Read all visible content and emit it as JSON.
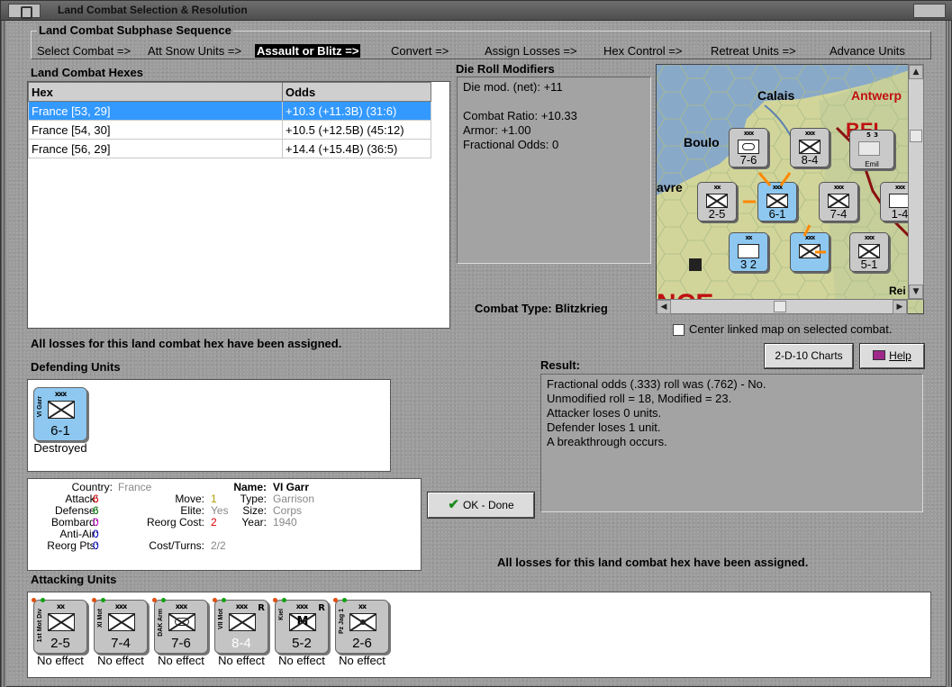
{
  "window": {
    "title": "Land Combat Selection & Resolution"
  },
  "sequence": {
    "title": "Land Combat Subphase Sequence",
    "steps": [
      {
        "label": "Select Combat =>",
        "active": false
      },
      {
        "label": "Att Snow Units =>",
        "active": false
      },
      {
        "label": "Assault or Blitz =>",
        "active": true
      },
      {
        "label": "Convert =>",
        "active": false
      },
      {
        "label": "Assign Losses =>",
        "active": false
      },
      {
        "label": "Hex Control =>",
        "active": false
      },
      {
        "label": "Retreat Units =>",
        "active": false
      },
      {
        "label": "Advance Units",
        "active": false
      }
    ]
  },
  "hexes": {
    "title": "Land Combat Hexes",
    "columns": [
      "Hex",
      "Odds"
    ],
    "rows": [
      {
        "hex": "France [53, 29]",
        "odds": "+10.3 (+11.3B) (31:6)",
        "selected": true
      },
      {
        "hex": "France [54, 30]",
        "odds": "+10.5 (+12.5B) (45:12)",
        "selected": false
      },
      {
        "hex": "France [56, 29]",
        "odds": "+14.4 (+15.4B) (36:5)",
        "selected": false
      }
    ],
    "status": "All losses for this land combat hex have been assigned."
  },
  "drm": {
    "title": "Die Roll Modifiers",
    "lines": [
      "Die mod. (net): +11",
      "",
      "Combat Ratio: +10.33",
      "Armor: +1.00",
      "Fractional Odds: 0"
    ]
  },
  "combat_type": {
    "label": "Combat Type:",
    "value": "Blitzkrieg"
  },
  "map": {
    "labels": [
      "Calais",
      "Antwerp",
      "Boulo",
      "avre",
      "Rei",
      "BEL"
    ],
    "center_label": "Center linked map on selected combat.",
    "center_checked": false
  },
  "buttons": {
    "charts": "2-D-10 Charts",
    "help": "Help",
    "ok": "OK - Done"
  },
  "defending": {
    "title": "Defending Units",
    "units": [
      {
        "side": "VI Garr",
        "size": "xxx",
        "strength": "6-1",
        "status": "Destroyed",
        "color": "#8ec8f0"
      }
    ]
  },
  "detail": {
    "country_k": "Country:",
    "country_v": "France",
    "attack_k": "Attack:",
    "attack_v": "6",
    "defense_k": "Defense:",
    "defense_v": "6",
    "bombard_k": "Bombard:",
    "bombard_v": "0",
    "antiair_k": "Anti-Air:",
    "antiair_v": "0",
    "reorgpts_k": "Reorg Pts:",
    "reorgpts_v": "0",
    "move_k": "Move:",
    "move_v": "1",
    "elite_k": "Elite:",
    "elite_v": "Yes",
    "reorgcost_k": "Reorg Cost:",
    "reorgcost_v": "2",
    "costturns_k": "Cost/Turns:",
    "costturns_v": "2/2",
    "name_k": "Name:",
    "name_v": "VI Garr",
    "type_k": "Type:",
    "type_v": "Garrison",
    "size_k": "Size:",
    "size_v": "Corps",
    "year_k": "Year:",
    "year_v": "1940"
  },
  "result": {
    "title": "Result:",
    "lines": [
      "Fractional odds (.333) roll was (.762)  - No.",
      "Unmodified roll = 18, Modified = 23.",
      "Attacker loses 0 units.",
      "Defender loses 1 unit.",
      "A breakthrough occurs."
    ],
    "footer": "All losses for this land combat hex have been assigned."
  },
  "attacking": {
    "title": "Attacking Units",
    "units": [
      {
        "side": "1st Mot Div",
        "size": "xx",
        "strength": "2-5",
        "status": "No effect",
        "r": "",
        "sym": "inf"
      },
      {
        "side": "XI Mot",
        "size": "xxx",
        "strength": "7-4",
        "status": "No effect",
        "r": "",
        "sym": "inf"
      },
      {
        "side": "DAK Arm",
        "size": "xxx",
        "strength": "7-6",
        "status": "No effect",
        "r": "",
        "sym": "armor"
      },
      {
        "side": "VII Mot",
        "size": "xxx",
        "strength": "8-4",
        "status": "No effect",
        "r": "R",
        "sym": "inf"
      },
      {
        "side": "Kiel",
        "size": "xxx",
        "strength": "5-2",
        "status": "No effect",
        "r": "R",
        "sym": "mtn"
      },
      {
        "side": "Pz Jag 1",
        "size": "xx",
        "strength": "2-6",
        "status": "No effect",
        "r": "",
        "sym": "at"
      }
    ]
  },
  "colors": {
    "selection": "#3399ff",
    "unit_grey": "#c4c4c4",
    "unit_blue": "#8ec8f0",
    "attack_red": "#e00000",
    "move_yellow": "#b0a000",
    "bombard_magenta": "#d000d0",
    "reorg_blue": "#0000d0"
  }
}
